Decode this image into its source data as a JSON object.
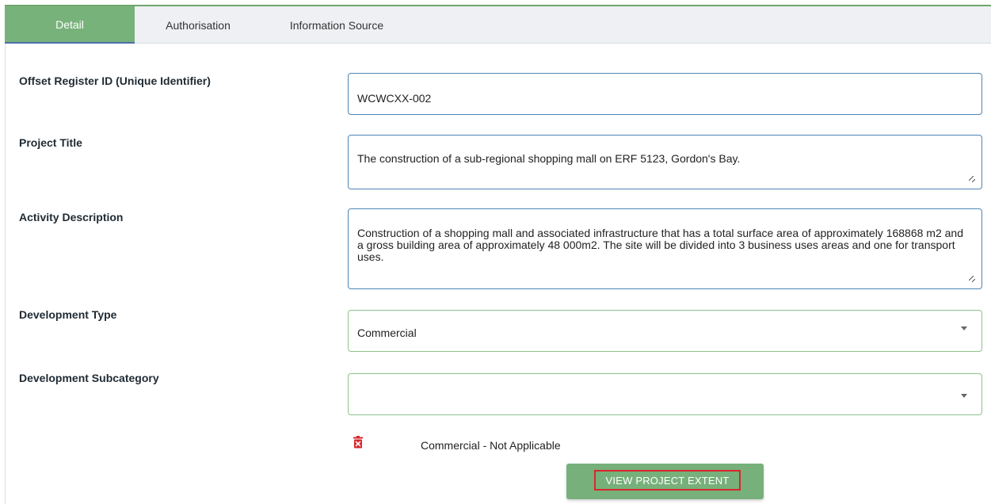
{
  "tabs": [
    {
      "label": "Detail",
      "active": true
    },
    {
      "label": "Authorisation",
      "active": false
    },
    {
      "label": "Information Source",
      "active": false
    }
  ],
  "form": {
    "offset_id": {
      "label": "Offset Register ID (Unique Identifier)",
      "value": "WCWCXX-002"
    },
    "project_title": {
      "label": "Project Title",
      "value": "The construction of a sub-regional shopping mall on ERF 5123, Gordon's Bay."
    },
    "activity_description": {
      "label": "Activity Description",
      "value": "Construction of a shopping mall and associated infrastructure that has a total surface area of approximately 168868 m2 and a gross building area of approximately 48 000m2. The site will be divided into 3 business uses areas and one for transport uses."
    },
    "development_type": {
      "label": "Development Type",
      "value": "Commercial"
    },
    "development_subcategory": {
      "label": "Development Subcategory",
      "value": ""
    }
  },
  "subcategory_item": {
    "text": "Commercial - Not Applicable",
    "icon": "trash-icon"
  },
  "actions": {
    "view_extent_label": "VIEW PROJECT EXTENT"
  },
  "colors": {
    "accent_green": "#78b27b",
    "focus_blue": "#4f86b6",
    "delete_red": "#d8262c"
  }
}
